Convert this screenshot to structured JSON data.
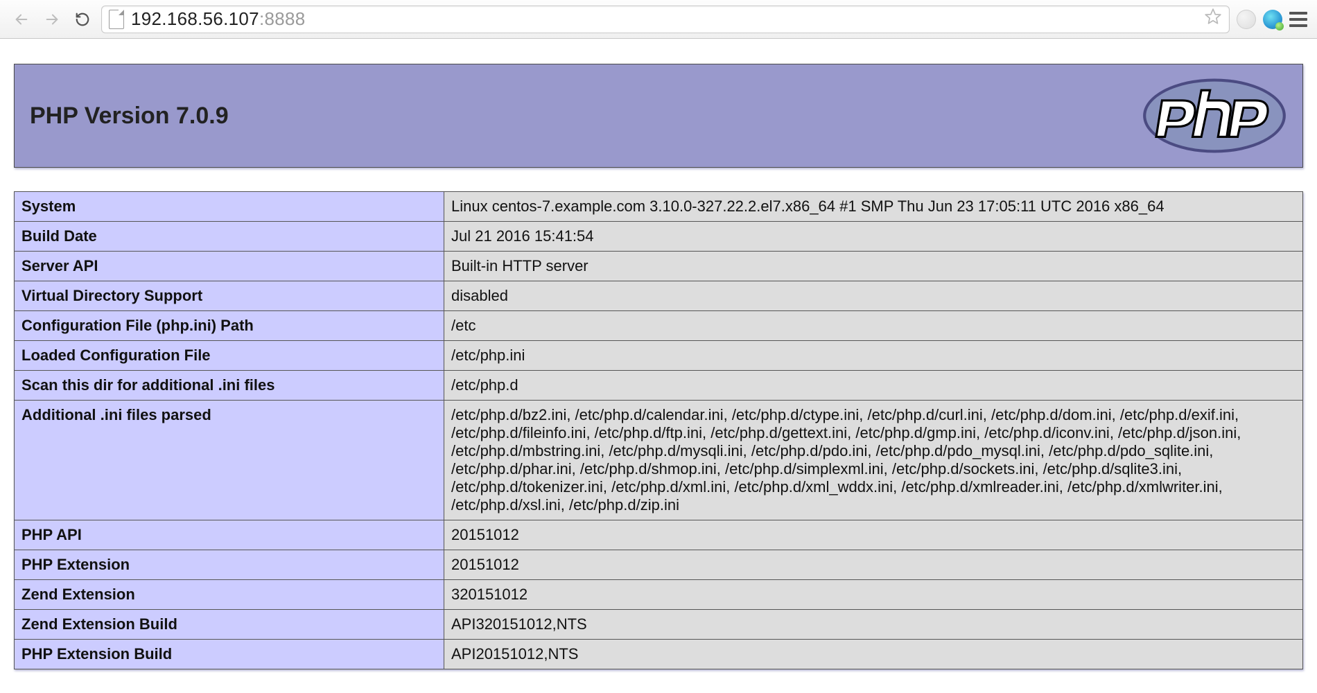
{
  "browser": {
    "url_host": "192.168.56.107",
    "url_port": ":8888"
  },
  "header": {
    "title": "PHP Version 7.0.9",
    "logo_alt": "php"
  },
  "rows": [
    {
      "label": "System",
      "value": "Linux centos-7.example.com 3.10.0-327.22.2.el7.x86_64 #1 SMP Thu Jun 23 17:05:11 UTC 2016 x86_64"
    },
    {
      "label": "Build Date",
      "value": "Jul 21 2016 15:41:54"
    },
    {
      "label": "Server API",
      "value": "Built-in HTTP server"
    },
    {
      "label": "Virtual Directory Support",
      "value": "disabled"
    },
    {
      "label": "Configuration File (php.ini) Path",
      "value": "/etc"
    },
    {
      "label": "Loaded Configuration File",
      "value": "/etc/php.ini"
    },
    {
      "label": "Scan this dir for additional .ini files",
      "value": "/etc/php.d"
    },
    {
      "label": "Additional .ini files parsed",
      "value": "/etc/php.d/bz2.ini, /etc/php.d/calendar.ini, /etc/php.d/ctype.ini, /etc/php.d/curl.ini, /etc/php.d/dom.ini, /etc/php.d/exif.ini, /etc/php.d/fileinfo.ini, /etc/php.d/ftp.ini, /etc/php.d/gettext.ini, /etc/php.d/gmp.ini, /etc/php.d/iconv.ini, /etc/php.d/json.ini, /etc/php.d/mbstring.ini, /etc/php.d/mysqli.ini, /etc/php.d/pdo.ini, /etc/php.d/pdo_mysql.ini, /etc/php.d/pdo_sqlite.ini, /etc/php.d/phar.ini, /etc/php.d/shmop.ini, /etc/php.d/simplexml.ini, /etc/php.d/sockets.ini, /etc/php.d/sqlite3.ini, /etc/php.d/tokenizer.ini, /etc/php.d/xml.ini, /etc/php.d/xml_wddx.ini, /etc/php.d/xmlreader.ini, /etc/php.d/xmlwriter.ini, /etc/php.d/xsl.ini, /etc/php.d/zip.ini"
    },
    {
      "label": "PHP API",
      "value": "20151012"
    },
    {
      "label": "PHP Extension",
      "value": "20151012"
    },
    {
      "label": "Zend Extension",
      "value": "320151012"
    },
    {
      "label": "Zend Extension Build",
      "value": "API320151012,NTS"
    },
    {
      "label": "PHP Extension Build",
      "value": "API20151012,NTS"
    }
  ]
}
